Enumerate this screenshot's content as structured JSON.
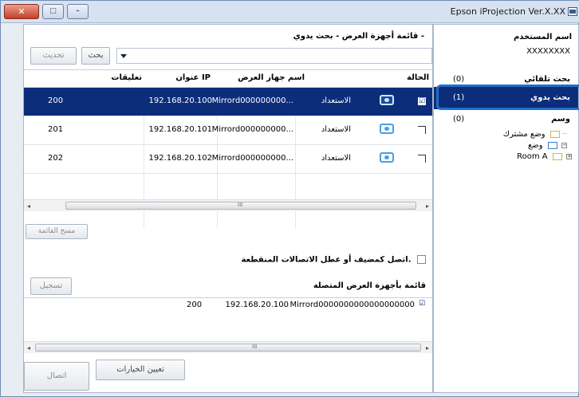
{
  "window": {
    "title": "Epson iProjection Ver.X.XX",
    "controls": {
      "close": "✕",
      "maximize": "□",
      "minimize": "–"
    }
  },
  "main": {
    "list_title": "قائمة أجهزة العرض - بحث يدوي -",
    "search_label": "بحث",
    "update_label": "تحديث",
    "search_value": "",
    "columns": [
      "الحالة",
      "اسم جهاز العرض",
      "عنوان IP",
      "تعليقات"
    ],
    "rows": [
      {
        "checked": "☑",
        "status": "الاستعداد",
        "name": "Mirrord000000000...",
        "ip": "192.168.20.100",
        "comment": "200"
      },
      {
        "checked": "",
        "status": "الاستعداد",
        "name": "Mirrord000000000...",
        "ip": "192.168.20.101",
        "comment": "201"
      },
      {
        "checked": "",
        "status": "الاستعداد",
        "name": "Mirrord000000000...",
        "ip": "192.168.20.102",
        "comment": "202"
      }
    ],
    "clear_list_label": "مسح القائمة",
    "moderator_check_label": "اتصل كمضيف أو عطل الاتصالات المنقطعة.",
    "connected_title": "قائمة بأجهزة العرض المتصلة",
    "register_label": "تسجيل",
    "connected": [
      {
        "checked": "☑",
        "name": "Mirrord0000000000000000000",
        "ip": "192.168.20.100",
        "comment": "200"
      }
    ],
    "set_options_label": "تعيين الخيارات",
    "connect_label": "اتصال",
    "scroll_grip": "III"
  },
  "sidebar": {
    "user_label": "اسم المستخدم",
    "user_name": "XXXXXXXX",
    "items": [
      {
        "label": "بحث تلقائي",
        "count": "(0)"
      },
      {
        "label": "بحث يدوي",
        "count": "(1)"
      },
      {
        "label": "وسم",
        "count": "(0)"
      }
    ],
    "tree": [
      {
        "label": "وضع مشترك"
      },
      {
        "label": "وضع"
      },
      {
        "label": "Room A"
      }
    ]
  }
}
